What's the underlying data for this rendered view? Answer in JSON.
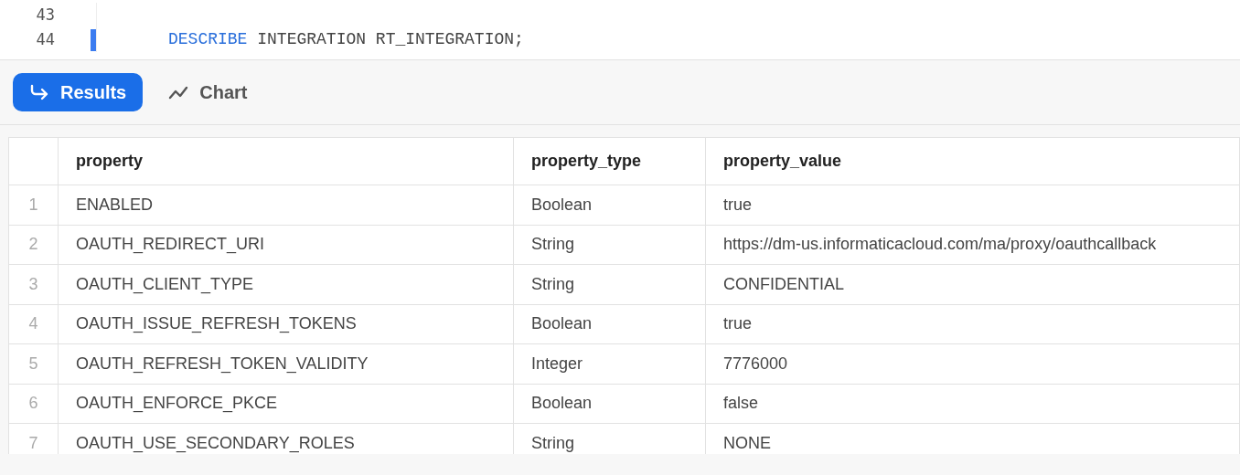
{
  "editor": {
    "lines": [
      {
        "number": "43"
      },
      {
        "number": "44",
        "current": true,
        "tokens": [
          {
            "kind": "keyword",
            "text": "DESCRIBE"
          },
          {
            "kind": "plain",
            "text": "INTEGRATION RT_INTEGRATION;"
          }
        ]
      }
    ]
  },
  "tabs": [
    {
      "label": "Results",
      "kind": "results",
      "selected": true
    },
    {
      "label": "Chart",
      "kind": "chart",
      "selected": false
    }
  ],
  "table": {
    "columns": [
      "property",
      "property_type",
      "property_value"
    ],
    "rows": [
      {
        "index": "1",
        "cells": [
          "ENABLED",
          "Boolean",
          "true"
        ]
      },
      {
        "index": "2",
        "cells": [
          "OAUTH_REDIRECT_URI",
          "String",
          "https://dm-us.informaticacloud.com/ma/proxy/oauthcallback"
        ]
      },
      {
        "index": "3",
        "cells": [
          "OAUTH_CLIENT_TYPE",
          "String",
          "CONFIDENTIAL"
        ]
      },
      {
        "index": "4",
        "cells": [
          "OAUTH_ISSUE_REFRESH_TOKENS",
          "Boolean",
          "true"
        ]
      },
      {
        "index": "5",
        "cells": [
          "OAUTH_REFRESH_TOKEN_VALIDITY",
          "Integer",
          "7776000"
        ]
      },
      {
        "index": "6",
        "cells": [
          "OAUTH_ENFORCE_PKCE",
          "Boolean",
          "false"
        ]
      },
      {
        "index": "7",
        "cells": [
          "OAUTH_USE_SECONDARY_ROLES",
          "String",
          "NONE"
        ]
      }
    ]
  }
}
